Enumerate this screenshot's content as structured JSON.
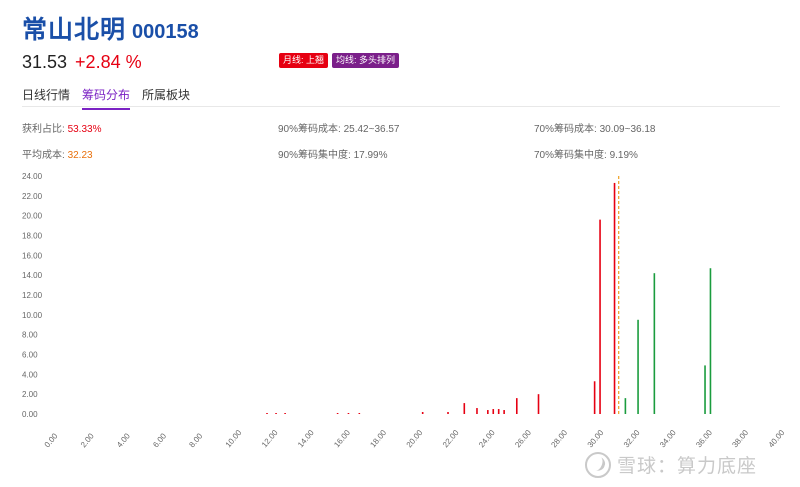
{
  "header": {
    "name": "常山北明",
    "code": "000158"
  },
  "quote": {
    "price": "31.53",
    "change": "+2.84 %"
  },
  "badges": [
    {
      "label": "月线: 上翘",
      "color": "#e60012"
    },
    {
      "label": "均线: 多头排列",
      "color": "#7b1f8a"
    }
  ],
  "tabs": [
    {
      "label": "日线行情",
      "active": false
    },
    {
      "label": "筹码分布",
      "active": true
    },
    {
      "label": "所属板块",
      "active": false
    }
  ],
  "stats": {
    "profit_ratio_label": "获利占比:",
    "profit_ratio_value": "53.33%",
    "cost90_label": "90%筹码成本:",
    "cost90_value": "25.42~36.57",
    "cost70_label": "70%筹码成本:",
    "cost70_value": "30.09~36.18",
    "avg_cost_label": "平均成本:",
    "avg_cost_value": "32.23",
    "conc90_label": "90%筹码集中度:",
    "conc90_value": "17.99%",
    "conc70_label": "70%筹码集中度:",
    "conc70_value": "9.19%"
  },
  "chart_data": {
    "type": "bar",
    "xlim": [
      0,
      40
    ],
    "ylim": [
      0,
      24
    ],
    "x_ticks": [
      "0.00",
      "2.00",
      "4.00",
      "6.00",
      "8.00",
      "10.00",
      "12.00",
      "14.00",
      "16.00",
      "18.00",
      "20.00",
      "22.00",
      "24.00",
      "26.00",
      "28.00",
      "30.00",
      "32.00",
      "34.00",
      "36.00",
      "38.00",
      "40.00"
    ],
    "y_ticks": [
      "0.00",
      "2.00",
      "4.00",
      "6.00",
      "8.00",
      "10.00",
      "12.00",
      "14.00",
      "16.00",
      "18.00",
      "20.00",
      "22.00",
      "24.00"
    ],
    "current_price": 31.53,
    "colors": {
      "profit": "#e60012",
      "loss": "#1a9c3e",
      "price_line": "#f0a020"
    },
    "series": [
      {
        "values": [
          [
            12.1,
            0.1
          ],
          [
            12.6,
            0.1
          ],
          [
            13.1,
            0.1
          ],
          [
            16.0,
            0.1
          ],
          [
            16.6,
            0.1
          ],
          [
            17.2,
            0.1
          ],
          [
            20.7,
            0.2
          ],
          [
            22.1,
            0.2
          ],
          [
            23.0,
            1.1
          ],
          [
            23.7,
            0.6
          ],
          [
            24.3,
            0.4
          ],
          [
            24.6,
            0.5
          ],
          [
            24.9,
            0.5
          ],
          [
            25.2,
            0.4
          ],
          [
            25.9,
            1.6
          ],
          [
            27.1,
            2.0
          ],
          [
            30.2,
            3.3
          ],
          [
            30.5,
            19.6
          ],
          [
            31.3,
            23.3
          ]
        ]
      },
      {
        "values": [
          [
            31.9,
            1.6
          ],
          [
            32.6,
            9.5
          ],
          [
            33.5,
            14.2
          ],
          [
            36.3,
            4.9
          ],
          [
            36.6,
            14.7
          ]
        ]
      }
    ]
  },
  "watermark": {
    "text": "雪球：算力底座"
  }
}
